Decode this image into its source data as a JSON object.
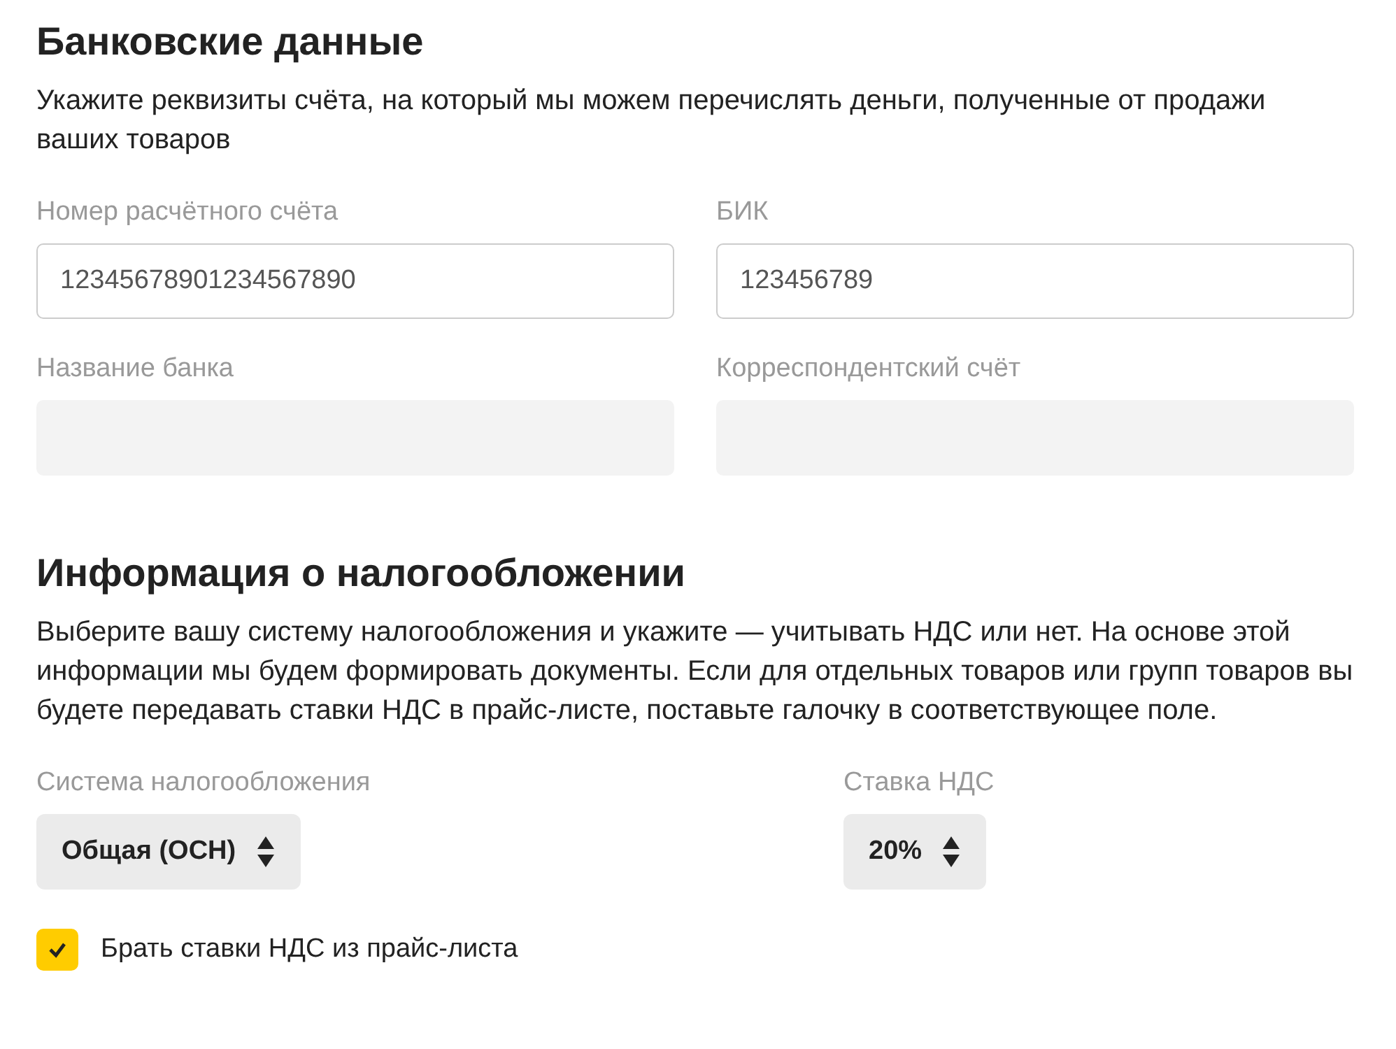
{
  "bank": {
    "title": "Банковские данные",
    "description": "Укажите реквизиты счёта, на который мы можем перечислять деньги, полученные от продажи ваших товаров",
    "fields": [
      {
        "label": "Номер расчётного счёта",
        "value": "12345678901234567890",
        "disabled": false
      },
      {
        "label": "БИК",
        "value": "123456789",
        "disabled": false
      },
      {
        "label": "Название банка",
        "disabled": true
      },
      {
        "label": "Корреспондентский счёт",
        "disabled": true
      }
    ]
  },
  "tax": {
    "title": "Информация о налогообложении",
    "description": "Выберите вашу систему налогообложения и укажите — учитывать НДС или нет. На основе этой информации мы будем формировать документы. Если для отдельных товаров или групп товаров вы будете передавать ставки НДС в прайс-листе, поставьте галочку в соответствующее поле.",
    "selects": [
      {
        "label": "Система налогообложения",
        "value": "Общая (ОСН)"
      },
      {
        "label": "Ставка НДС",
        "value": "20%"
      }
    ],
    "checkbox": {
      "label": "Брать ставки НДС из прайс-листа",
      "checked": true
    }
  }
}
